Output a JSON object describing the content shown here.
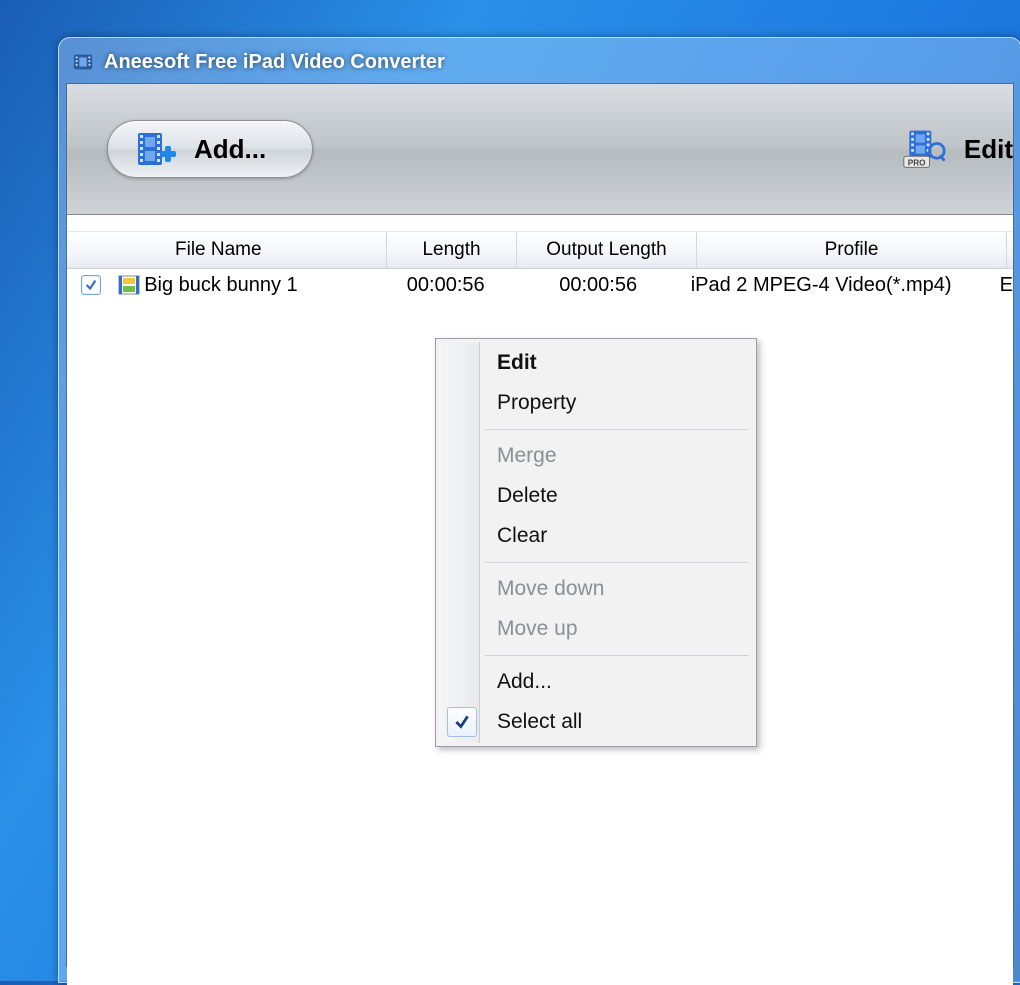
{
  "window": {
    "title": "Aneesoft Free iPad Video Converter"
  },
  "toolbar": {
    "add_label": "Add...",
    "edit_label": "Edit",
    "pro_badge": "PRO"
  },
  "table": {
    "headers": {
      "filename": "File Name",
      "length": "Length",
      "output_length": "Output Length",
      "profile": "Profile"
    },
    "rows": [
      {
        "checked": true,
        "filename": "Big buck bunny 1",
        "length": "00:00:56",
        "output_length": "00:00:56",
        "profile": "iPad 2 MPEG-4 Video(*.mp4)",
        "trailing": "E"
      }
    ]
  },
  "context_menu": {
    "items": [
      {
        "label": "Edit",
        "bold": true,
        "enabled": true
      },
      {
        "label": "Property",
        "enabled": true
      },
      {
        "sep": true
      },
      {
        "label": "Merge",
        "enabled": false
      },
      {
        "label": "Delete",
        "enabled": true
      },
      {
        "label": "Clear",
        "enabled": true
      },
      {
        "sep": true
      },
      {
        "label": "Move down",
        "enabled": false
      },
      {
        "label": "Move up",
        "enabled": false
      },
      {
        "sep": true
      },
      {
        "label": "Add...",
        "enabled": true
      },
      {
        "label": "Select all",
        "enabled": true,
        "checked": true
      }
    ]
  }
}
